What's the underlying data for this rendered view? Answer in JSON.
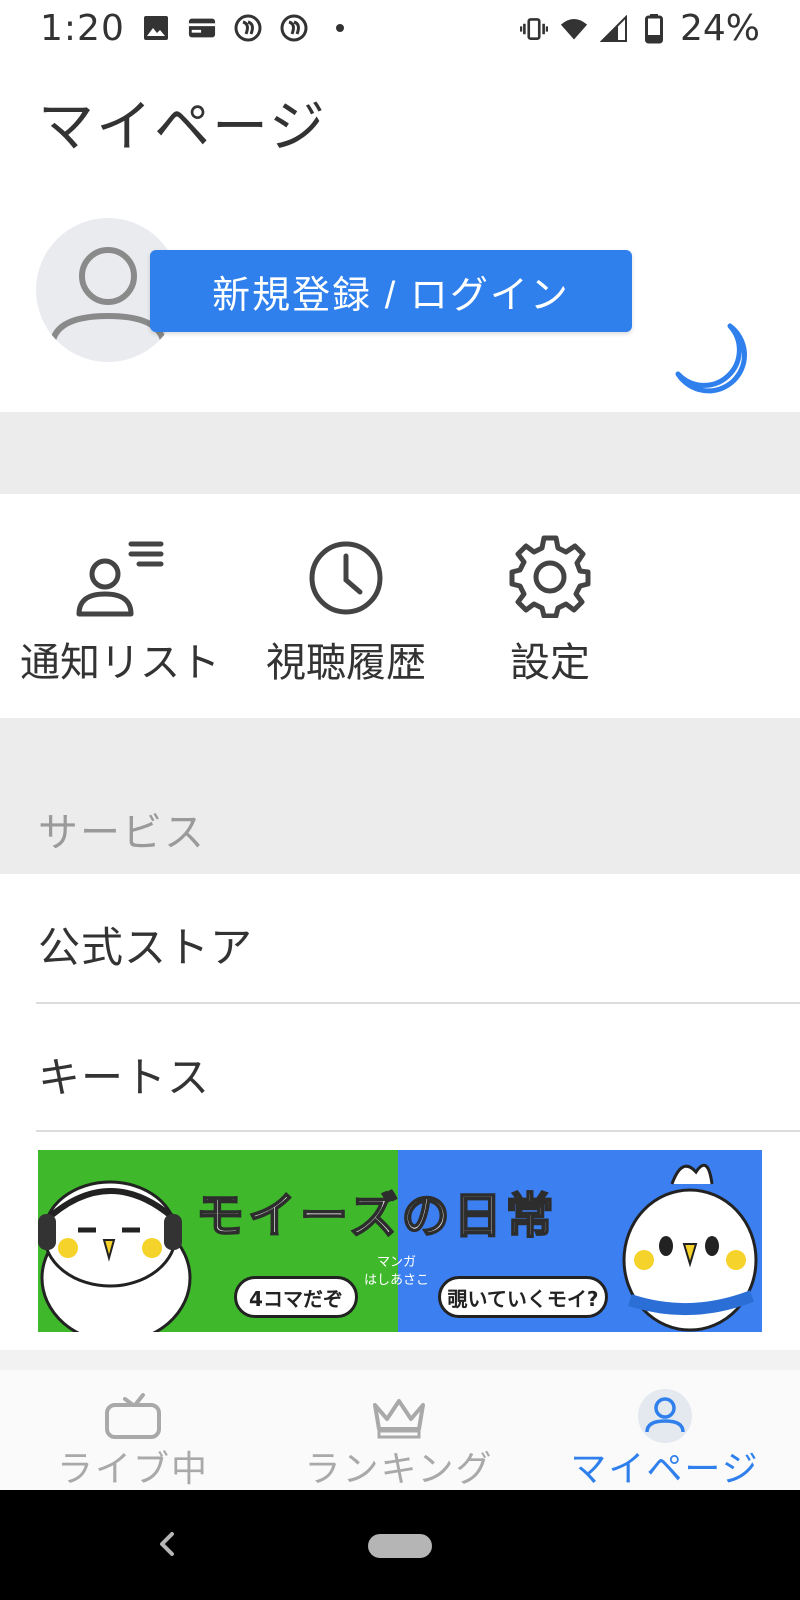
{
  "status_bar": {
    "time": "1:20",
    "battery_percent": "24%",
    "left_icons": [
      "image-icon",
      "card-icon",
      "app-icon",
      "app-icon",
      "dot-icon"
    ],
    "right_icons": [
      "vibrate-icon",
      "wifi-icon",
      "signal-icon",
      "battery-icon"
    ]
  },
  "header": {
    "title": "マイページ"
  },
  "profile": {
    "login_button_label": "新規登録 / ログイン",
    "theme_toggle_icon": "moon-icon"
  },
  "actions": [
    {
      "label": "通知リスト",
      "icon": "notification-list-icon"
    },
    {
      "label": "視聴履歴",
      "icon": "clock-icon"
    },
    {
      "label": "設定",
      "icon": "gear-icon"
    }
  ],
  "services": {
    "section_label": "サービス",
    "items": [
      {
        "label": "公式ストア"
      },
      {
        "label": "キートス"
      }
    ]
  },
  "banner": {
    "title": "モイーズの日常",
    "sub_caption": "マンガ",
    "author": "はしあさこ",
    "bubble_left": "4コマだぞ",
    "bubble_right": "覗いていくモイ?",
    "colors": {
      "left": "#3fb82b",
      "right": "#3b7ff0"
    }
  },
  "bottom_nav": {
    "items": [
      {
        "label": "ライブ中",
        "icon": "tv-icon",
        "active": false
      },
      {
        "label": "ランキング",
        "icon": "crown-icon",
        "active": false
      },
      {
        "label": "マイページ",
        "icon": "user-icon",
        "active": true
      }
    ]
  },
  "colors": {
    "accent": "#2f80ed",
    "section_bg": "#ececec",
    "inactive": "#a9a9a9"
  }
}
